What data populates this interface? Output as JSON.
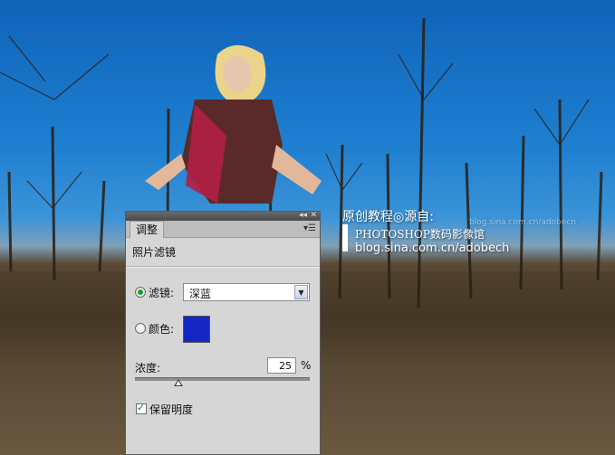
{
  "watermark": {
    "line1": "原创教程◎源自:",
    "line2": "PHOTOSHOP数码影像馆",
    "line3": "blog.sina.com.cn/adobech",
    "faint": "blog.sina.com.cn/adobecn"
  },
  "panel": {
    "tab_label": "调整",
    "title": "照片滤镜",
    "collapse_icon": "double-chevron-icon",
    "close_icon": "close-icon",
    "menu_icon": "panel-menu-icon",
    "filter_label": "滤镜:",
    "filter_value": "深蓝",
    "filter_selected": true,
    "color_label": "颜色:",
    "color_selected": false,
    "color_swatch": "#1427c4",
    "density_label": "浓度:",
    "density_value": "25",
    "density_unit": "%",
    "density_fraction": 0.25,
    "preserve_label": "保留明度",
    "preserve_checked": true
  }
}
